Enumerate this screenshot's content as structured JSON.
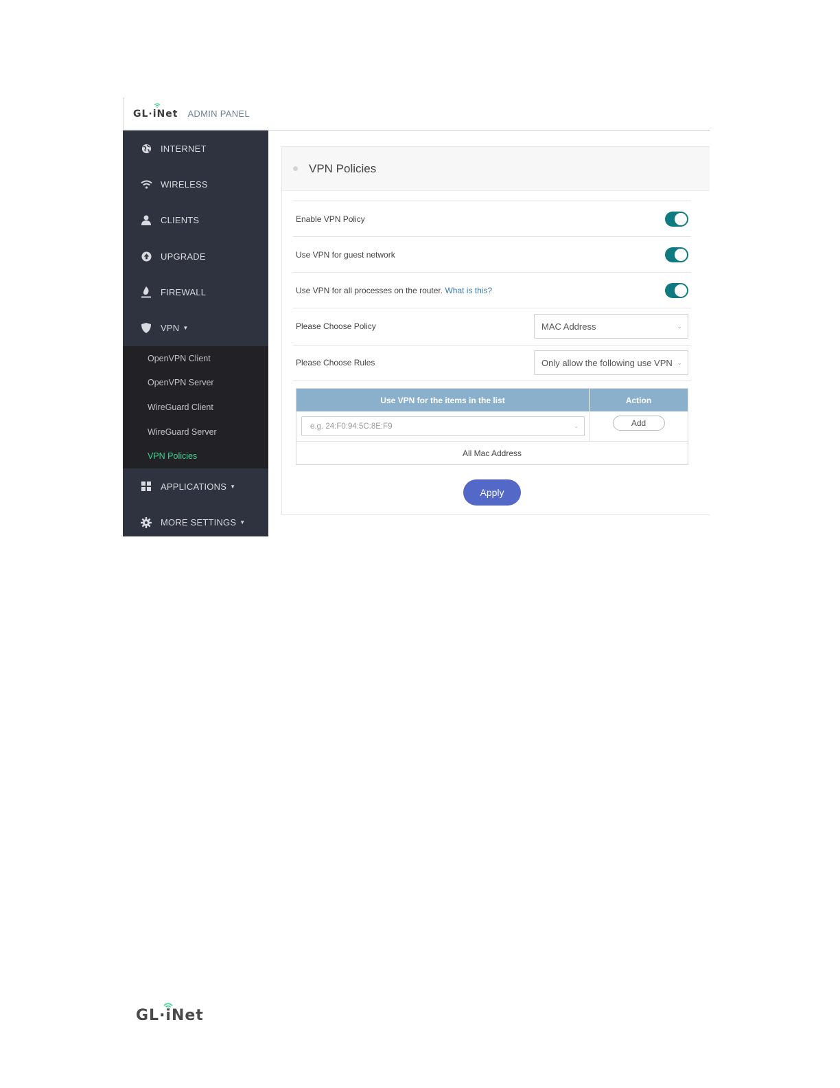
{
  "header": {
    "logo_text": "GL·iNet",
    "admin_label": "ADMIN PANEL"
  },
  "sidebar": {
    "items": [
      {
        "label": "INTERNET",
        "icon": "globe-icon"
      },
      {
        "label": "WIRELESS",
        "icon": "wifi-icon"
      },
      {
        "label": "CLIENTS",
        "icon": "user-icon"
      },
      {
        "label": "UPGRADE",
        "icon": "upload-icon"
      },
      {
        "label": "FIREWALL",
        "icon": "flame-icon"
      },
      {
        "label": "VPN",
        "icon": "shield-icon"
      }
    ],
    "vpn_submenu": [
      {
        "label": "OpenVPN Client"
      },
      {
        "label": "OpenVPN Server"
      },
      {
        "label": "WireGuard Client"
      },
      {
        "label": "WireGuard Server"
      },
      {
        "label": "VPN Policies"
      }
    ],
    "bottom_items": [
      {
        "label": "APPLICATIONS",
        "icon": "grid-icon"
      },
      {
        "label": "MORE SETTINGS",
        "icon": "gear-icon"
      }
    ],
    "active_color": "#3ed190"
  },
  "panel": {
    "title": "VPN Policies",
    "enable_policy_label": "Enable VPN Policy",
    "guest_label": "Use VPN for guest network",
    "processes_label": "Use VPN for all processes on the router.",
    "processes_link": "What is this?",
    "choose_policy_label": "Please Choose Policy",
    "choose_policy_value": "MAC Address",
    "choose_rules_label": "Please Choose Rules",
    "choose_rules_value": "Only allow the following use VPN",
    "toggles": {
      "enable_policy": true,
      "guest_network": true,
      "all_processes": true
    },
    "toggle_color": "#0f7b80"
  },
  "table": {
    "col_items": "Use VPN for the items in the list",
    "col_action": "Action",
    "mac_placeholder": "e.g. 24:F0:94:5C:8E:F9",
    "add_label": "Add",
    "footer_text": "All Mac Address"
  },
  "apply_label": "Apply",
  "footer_logo_text": "GL·iNet"
}
